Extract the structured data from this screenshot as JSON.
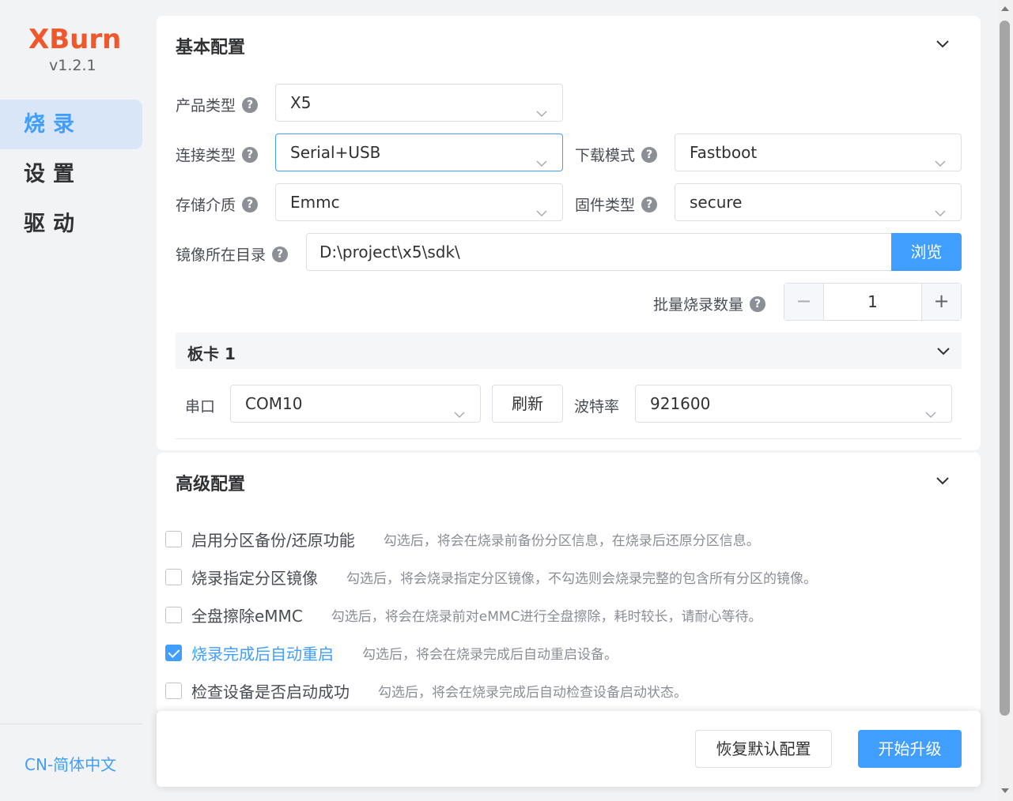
{
  "app": {
    "name": "XBurn",
    "version": "v1.2.1"
  },
  "nav": [
    {
      "label": "烧录",
      "active": true
    },
    {
      "label": "设置",
      "active": false
    },
    {
      "label": "驱动",
      "active": false
    }
  ],
  "language": "CN-简体中文",
  "basic": {
    "title": "基本配置",
    "product_type": {
      "label": "产品类型",
      "value": "X5"
    },
    "connection_type": {
      "label": "连接类型",
      "value": "Serial+USB"
    },
    "download_mode": {
      "label": "下载模式",
      "value": "Fastboot"
    },
    "storage": {
      "label": "存储介质",
      "value": "Emmc"
    },
    "firmware_type": {
      "label": "固件类型",
      "value": "secure"
    },
    "image_dir": {
      "label": "镜像所在目录",
      "value": "D:\\project\\x5\\sdk\\",
      "browse": "浏览"
    },
    "batch": {
      "label": "批量烧录数量",
      "value": "1",
      "minus": "−",
      "plus": "+"
    },
    "board": {
      "title": "板卡 1",
      "port_label": "串口",
      "port_value": "COM10",
      "refresh": "刷新",
      "baud_label": "波特率",
      "baud_value": "921600"
    }
  },
  "advanced": {
    "title": "高级配置",
    "options": [
      {
        "label": "启用分区备份/还原功能",
        "desc": "勾选后，将会在烧录前备份分区信息，在烧录后还原分区信息。",
        "checked": false
      },
      {
        "label": "烧录指定分区镜像",
        "desc": "勾选后，将会烧录指定分区镜像，不勾选则会烧录完整的包含所有分区的镜像。",
        "checked": false
      },
      {
        "label": "全盘擦除eMMC",
        "desc": "勾选后，将会在烧录前对eMMC进行全盘擦除，耗时较长，请耐心等待。",
        "checked": false
      },
      {
        "label": "烧录完成后自动重启",
        "desc": "勾选后，将会在烧录完成后自动重启设备。",
        "checked": true
      },
      {
        "label": "检查设备是否启动成功",
        "desc": "勾选后，将会在烧录完成后自动检查设备启动状态。",
        "checked": false
      }
    ]
  },
  "footer": {
    "reset": "恢复默认配置",
    "start": "开始升级"
  },
  "colors": {
    "primary": "#409eff",
    "brand": "#f0582b"
  }
}
